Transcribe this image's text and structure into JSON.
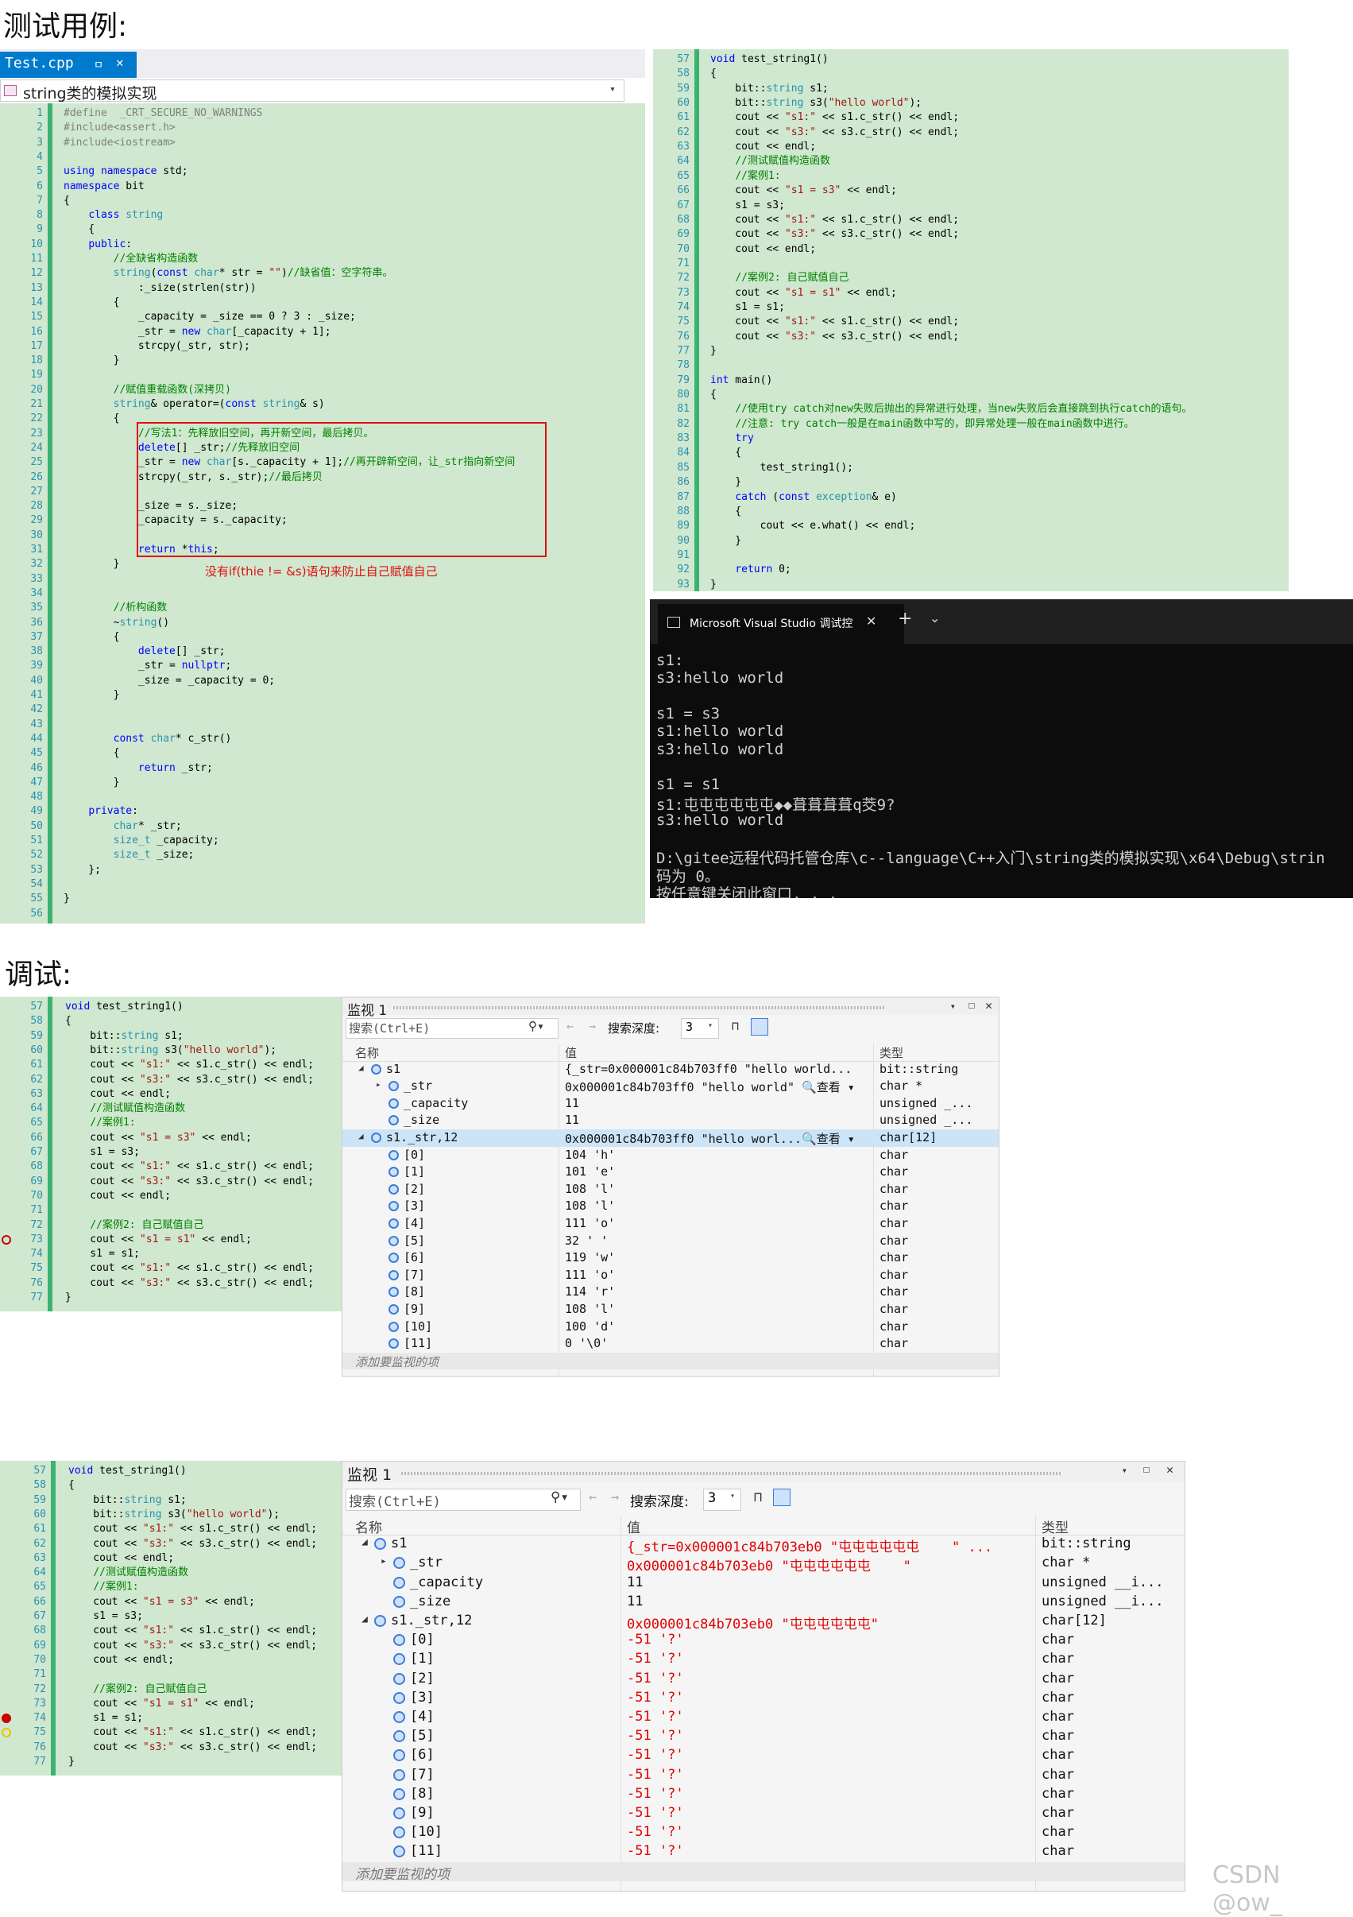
{
  "headings": {
    "top": "测试用例:",
    "debug": "调试:"
  },
  "left_editor": {
    "tab_label": "Test.cpp",
    "tab_pin": "ㅁ",
    "tab_close": "✕",
    "scope": "string类的模拟实现",
    "annotation": "没有if(thie != &s)语句来防止自己赋值自己",
    "lines": [
      [
        "1",
        "#define  _CRT_SECURE_NO_WARNINGS"
      ],
      [
        "2",
        "#include<assert.h>"
      ],
      [
        "3",
        "#include<iostream>"
      ],
      [
        "4",
        ""
      ],
      [
        "5",
        "using namespace std;"
      ],
      [
        "6",
        "namespace bit"
      ],
      [
        "7",
        "{"
      ],
      [
        "8",
        "    class string"
      ],
      [
        "9",
        "    {"
      ],
      [
        "10",
        "    public:"
      ],
      [
        "11",
        "        //全缺省构造函数"
      ],
      [
        "12",
        "        string(const char* str = \"\")//缺省值：空字符串。"
      ],
      [
        "13",
        "            :_size(strlen(str))"
      ],
      [
        "14",
        "        {"
      ],
      [
        "15",
        "            _capacity = _size == 0 ? 3 : _size;"
      ],
      [
        "16",
        "            _str = new char[_capacity + 1];"
      ],
      [
        "17",
        "            strcpy(_str, str);"
      ],
      [
        "18",
        "        }"
      ],
      [
        "19",
        ""
      ],
      [
        "20",
        "        //赋值重载函数(深拷贝)"
      ],
      [
        "21",
        "        string& operator=(const string& s)"
      ],
      [
        "22",
        "        {"
      ],
      [
        "23",
        "            //写法1：先释放旧空间，再开新空间，最后拷贝。"
      ],
      [
        "24",
        "            delete[] _str;//先释放旧空间"
      ],
      [
        "25",
        "            _str = new char[s._capacity + 1];//再开辟新空间，让_str指向新空间"
      ],
      [
        "26",
        "            strcpy(_str, s._str);//最后拷贝"
      ],
      [
        "27",
        ""
      ],
      [
        "28",
        "            _size = s._size;"
      ],
      [
        "29",
        "            _capacity = s._capacity;"
      ],
      [
        "30",
        ""
      ],
      [
        "31",
        "            return *this;"
      ],
      [
        "32",
        "        }"
      ],
      [
        "33",
        ""
      ],
      [
        "34",
        ""
      ],
      [
        "35",
        "        //析构函数"
      ],
      [
        "36",
        "        ~string()"
      ],
      [
        "37",
        "        {"
      ],
      [
        "38",
        "            delete[] _str;"
      ],
      [
        "39",
        "            _str = nullptr;"
      ],
      [
        "40",
        "            _size = _capacity = 0;"
      ],
      [
        "41",
        "        }"
      ],
      [
        "42",
        ""
      ],
      [
        "43",
        ""
      ],
      [
        "44",
        "        const char* c_str()"
      ],
      [
        "45",
        "        {"
      ],
      [
        "46",
        "            return _str;"
      ],
      [
        "47",
        "        }"
      ],
      [
        "48",
        ""
      ],
      [
        "49",
        "    private:"
      ],
      [
        "50",
        "        char* _str;"
      ],
      [
        "51",
        "        size_t _capacity;"
      ],
      [
        "52",
        "        size_t _size;"
      ],
      [
        "53",
        "    };"
      ],
      [
        "54",
        ""
      ],
      [
        "55",
        "}"
      ],
      [
        "56",
        ""
      ]
    ]
  },
  "right_editor": {
    "lines": [
      [
        "57",
        "void test_string1()"
      ],
      [
        "58",
        "{"
      ],
      [
        "59",
        "    bit::string s1;"
      ],
      [
        "60",
        "    bit::string s3(\"hello world\");"
      ],
      [
        "61",
        "    cout << \"s1:\" << s1.c_str() << endl;"
      ],
      [
        "62",
        "    cout << \"s3:\" << s3.c_str() << endl;"
      ],
      [
        "63",
        "    cout << endl;"
      ],
      [
        "64",
        "    //测试赋值构造函数"
      ],
      [
        "65",
        "    //案例1:"
      ],
      [
        "66",
        "    cout << \"s1 = s3\" << endl;"
      ],
      [
        "67",
        "    s1 = s3;"
      ],
      [
        "68",
        "    cout << \"s1:\" << s1.c_str() << endl;"
      ],
      [
        "69",
        "    cout << \"s3:\" << s3.c_str() << endl;"
      ],
      [
        "70",
        "    cout << endl;"
      ],
      [
        "71",
        ""
      ],
      [
        "72",
        "    //案例2: 自己赋值自己"
      ],
      [
        "73",
        "    cout << \"s1 = s1\" << endl;"
      ],
      [
        "74",
        "    s1 = s1;"
      ],
      [
        "75",
        "    cout << \"s1:\" << s1.c_str() << endl;"
      ],
      [
        "76",
        "    cout << \"s3:\" << s3.c_str() << endl;"
      ],
      [
        "77",
        "}"
      ],
      [
        "78",
        ""
      ],
      [
        "79",
        "int main()"
      ],
      [
        "80",
        "{"
      ],
      [
        "81",
        "    //使用try catch对new失败后抛出的异常进行处理，当new失败后会直接跳到执行catch的语句。"
      ],
      [
        "82",
        "    //注意: try catch一般是在main函数中写的，即异常处理一般在main函数中进行。"
      ],
      [
        "83",
        "    try"
      ],
      [
        "84",
        "    {"
      ],
      [
        "85",
        "        test_string1();"
      ],
      [
        "86",
        "    }"
      ],
      [
        "87",
        "    catch (const exception& e)"
      ],
      [
        "88",
        "    {"
      ],
      [
        "89",
        "        cout << e.what() << endl;"
      ],
      [
        "90",
        "    }"
      ],
      [
        "91",
        ""
      ],
      [
        "92",
        "    return 0;"
      ],
      [
        "93",
        "}"
      ]
    ]
  },
  "console": {
    "tab_title": "Microsoft Visual Studio 调试控",
    "tab_close": "✕",
    "new_tab": "+",
    "dropdown": "⌄",
    "lines": [
      "s1:",
      "s3:hello world",
      "",
      "s1 = s3",
      "s1:hello world",
      "s3:hello world",
      "",
      "s1 = s1",
      "s1:屯屯屯屯屯屯◆◆葺葺葺葺q茭9?",
      "s3:hello world",
      "",
      "D:\\gitee远程代码托管仓库\\c--language\\C++入门\\string类的模拟实现\\x64\\Debug\\strin",
      "码为 0。",
      "按任意键关闭此窗口. . ."
    ]
  },
  "debug_code_lines": [
    [
      "57",
      "void test_string1()"
    ],
    [
      "58",
      "{"
    ],
    [
      "59",
      "    bit::string s1;"
    ],
    [
      "60",
      "    bit::string s3(\"hello world\");"
    ],
    [
      "61",
      "    cout << \"s1:\" << s1.c_str() << endl;"
    ],
    [
      "62",
      "    cout << \"s3:\" << s3.c_str() << endl;"
    ],
    [
      "63",
      "    cout << endl;"
    ],
    [
      "64",
      "    //测试赋值构造函数"
    ],
    [
      "65",
      "    //案例1:"
    ],
    [
      "66",
      "    cout << \"s1 = s3\" << endl;"
    ],
    [
      "67",
      "    s1 = s3;"
    ],
    [
      "68",
      "    cout << \"s1:\" << s1.c_str() << endl;"
    ],
    [
      "69",
      "    cout << \"s3:\" << s3.c_str() << endl;"
    ],
    [
      "70",
      "    cout << endl;"
    ],
    [
      "71",
      ""
    ],
    [
      "72",
      "    //案例2: 自己赋值自己"
    ],
    [
      "73",
      "    cout << \"s1 = s1\" << endl;"
    ],
    [
      "74",
      "    s1 = s1;"
    ],
    [
      "75",
      "    cout << \"s1:\" << s1.c_str() << endl;"
    ],
    [
      "76",
      "    cout << \"s3:\" << s3.c_str() << endl;"
    ],
    [
      "77",
      "}"
    ]
  ],
  "watch1": {
    "title": "监视 1",
    "search_placeholder": "搜索(Ctrl+E)",
    "search_depth_label": "搜索深度:",
    "search_depth_value": "3",
    "col_name": "名称",
    "col_value": "值",
    "col_type": "类型",
    "add_item": "添加要监视的项",
    "rows": [
      {
        "name": "s1",
        "value": "{_str=0x000001c84b703ff0 \"hello world...",
        "type": "bit::string",
        "level": 0,
        "expand": "◢"
      },
      {
        "name": "_str",
        "value": "0x000001c84b703ff0 \"hello world\" 🔍查看 ▾",
        "type": "char *",
        "level": 1,
        "expand": "▸"
      },
      {
        "name": "_capacity",
        "value": "11",
        "type": "unsigned _...",
        "level": 1,
        "expand": ""
      },
      {
        "name": "_size",
        "value": "11",
        "type": "unsigned _...",
        "level": 1,
        "expand": ""
      },
      {
        "name": "s1._str,12",
        "value": "0x000001c84b703ff0 \"hello worl...🔍查看 ▾",
        "type": "char[12]",
        "level": 0,
        "expand": "◢",
        "selected": true
      },
      {
        "name": "[0]",
        "value": "104 'h'",
        "type": "char",
        "level": 1,
        "expand": ""
      },
      {
        "name": "[1]",
        "value": "101 'e'",
        "type": "char",
        "level": 1,
        "expand": ""
      },
      {
        "name": "[2]",
        "value": "108 'l'",
        "type": "char",
        "level": 1,
        "expand": ""
      },
      {
        "name": "[3]",
        "value": "108 'l'",
        "type": "char",
        "level": 1,
        "expand": ""
      },
      {
        "name": "[4]",
        "value": "111 'o'",
        "type": "char",
        "level": 1,
        "expand": ""
      },
      {
        "name": "[5]",
        "value": "32 ' '",
        "type": "char",
        "level": 1,
        "expand": ""
      },
      {
        "name": "[6]",
        "value": "119 'w'",
        "type": "char",
        "level": 1,
        "expand": ""
      },
      {
        "name": "[7]",
        "value": "111 'o'",
        "type": "char",
        "level": 1,
        "expand": ""
      },
      {
        "name": "[8]",
        "value": "114 'r'",
        "type": "char",
        "level": 1,
        "expand": ""
      },
      {
        "name": "[9]",
        "value": "108 'l'",
        "type": "char",
        "level": 1,
        "expand": ""
      },
      {
        "name": "[10]",
        "value": "100 'd'",
        "type": "char",
        "level": 1,
        "expand": ""
      },
      {
        "name": "[11]",
        "value": "0 '\\0'",
        "type": "char",
        "level": 1,
        "expand": ""
      }
    ]
  },
  "watch2": {
    "title": "监视 1",
    "search_placeholder": "搜索(Ctrl+E)",
    "search_depth_label": "搜索深度:",
    "search_depth_value": "3",
    "col_name": "名称",
    "col_value": "值",
    "col_type": "类型",
    "add_item": "添加要监视的项",
    "rows": [
      {
        "name": "s1",
        "value": "{_str=0x000001c84b703eb0 \"屯屯屯屯屯屯    \" ...",
        "type": "bit::string",
        "level": 0,
        "expand": "◢",
        "red": true
      },
      {
        "name": "_str",
        "value": "0x000001c84b703eb0 \"屯屯屯屯屯屯    \"",
        "type": "char *",
        "level": 1,
        "expand": "▸",
        "red": true
      },
      {
        "name": "_capacity",
        "value": "11",
        "type": "unsigned __i...",
        "level": 1,
        "expand": ""
      },
      {
        "name": "_size",
        "value": "11",
        "type": "unsigned __i...",
        "level": 1,
        "expand": ""
      },
      {
        "name": "s1._str,12",
        "value": "0x000001c84b703eb0 \"屯屯屯屯屯屯\"",
        "type": "char[12]",
        "level": 0,
        "expand": "◢",
        "red": true
      },
      {
        "name": "[0]",
        "value": "-51 '?'",
        "type": "char",
        "level": 1,
        "expand": "",
        "red": true
      },
      {
        "name": "[1]",
        "value": "-51 '?'",
        "type": "char",
        "level": 1,
        "expand": "",
        "red": true
      },
      {
        "name": "[2]",
        "value": "-51 '?'",
        "type": "char",
        "level": 1,
        "expand": "",
        "red": true
      },
      {
        "name": "[3]",
        "value": "-51 '?'",
        "type": "char",
        "level": 1,
        "expand": "",
        "red": true
      },
      {
        "name": "[4]",
        "value": "-51 '?'",
        "type": "char",
        "level": 1,
        "expand": "",
        "red": true
      },
      {
        "name": "[5]",
        "value": "-51 '?'",
        "type": "char",
        "level": 1,
        "expand": "",
        "red": true
      },
      {
        "name": "[6]",
        "value": "-51 '?'",
        "type": "char",
        "level": 1,
        "expand": "",
        "red": true
      },
      {
        "name": "[7]",
        "value": "-51 '?'",
        "type": "char",
        "level": 1,
        "expand": "",
        "red": true
      },
      {
        "name": "[8]",
        "value": "-51 '?'",
        "type": "char",
        "level": 1,
        "expand": "",
        "red": true
      },
      {
        "name": "[9]",
        "value": "-51 '?'",
        "type": "char",
        "level": 1,
        "expand": "",
        "red": true
      },
      {
        "name": "[10]",
        "value": "-51 '?'",
        "type": "char",
        "level": 1,
        "expand": "",
        "red": true
      },
      {
        "name": "[11]",
        "value": "-51 '?'",
        "type": "char",
        "level": 1,
        "expand": "",
        "red": true
      }
    ]
  },
  "watermark": "CSDN @ow_"
}
